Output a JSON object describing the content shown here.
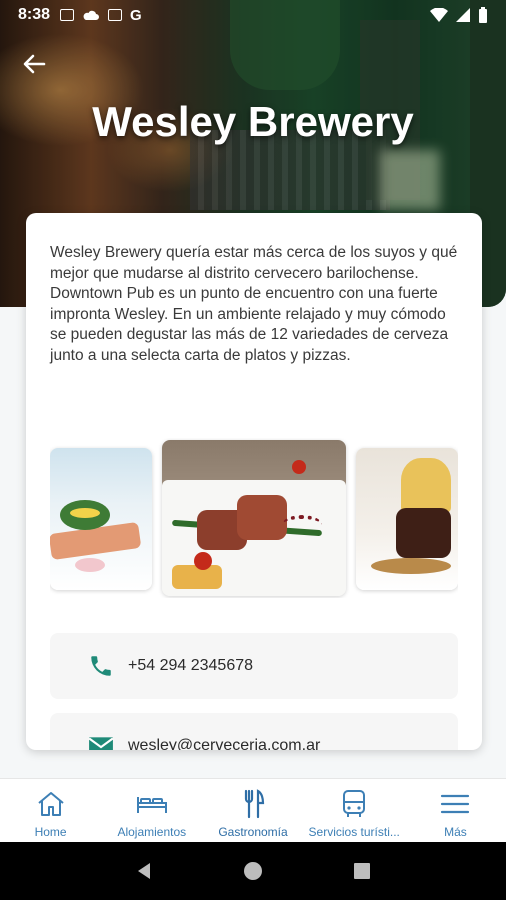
{
  "status_bar": {
    "time": "8:38",
    "g_label": "G"
  },
  "header": {
    "title": "Wesley Brewery"
  },
  "description": "Wesley Brewery quería estar más cerca de los suyos y qué mejor que mudarse al distrito cervecero barilochense. Downtown Pub es un punto de encuentro con una fuerte impronta Wesley. En un ambiente relajado y muy cómodo se pueden degustar las más de 12 variedades de cerveza junto a una selecta carta de platos y pizzas.",
  "contacts": {
    "phone": "+54 294 2345678",
    "email": "wesley@cerveceria.com.ar"
  },
  "bottom_nav": [
    {
      "label": "Home",
      "icon": "home-icon"
    },
    {
      "label": "Alojamientos",
      "icon": "bed-icon"
    },
    {
      "label": "Gastronomía",
      "icon": "cutlery-icon"
    },
    {
      "label": "Servicios turísti...",
      "icon": "bus-icon"
    },
    {
      "label": "Más",
      "icon": "menu-icon"
    }
  ],
  "colors": {
    "accent": "#2f6ea6",
    "contact_icon": "#1f8a78"
  }
}
